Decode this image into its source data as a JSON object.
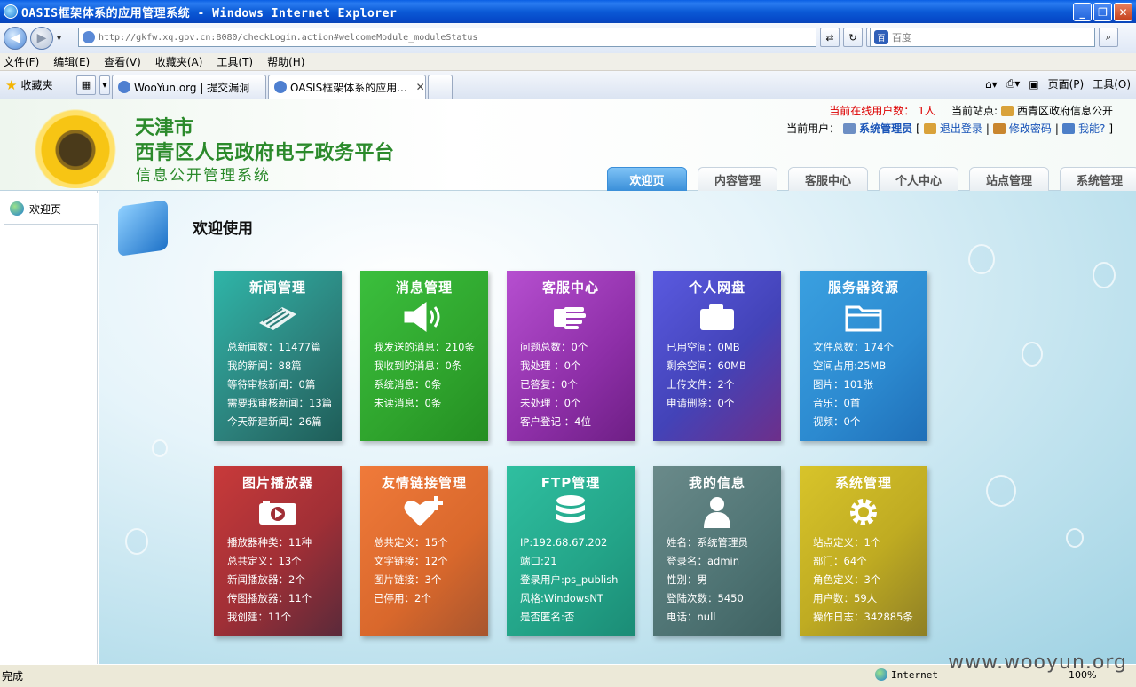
{
  "window": {
    "title": "OASIS框架体系的应用管理系统 - Windows Internet Explorer",
    "buttons": [
      "_",
      "❐",
      "✕"
    ]
  },
  "address": {
    "url": "http://gkfw.xq.gov.cn:8080/checkLogin.action#welcomeModule_moduleStatus",
    "search_placeholder": "百度"
  },
  "menu": [
    "文件(F)",
    "编辑(E)",
    "查看(V)",
    "收藏夹(A)",
    "工具(T)",
    "帮助(H)"
  ],
  "tabbar": {
    "favorites": "收藏夹",
    "tabs": [
      "WooYun.org | 提交漏洞",
      "OASIS框架体系的应用..."
    ],
    "right_page": "页面(P)",
    "right_tools": "工具(O)"
  },
  "header": {
    "logo_line1": "天津市",
    "logo_line2": "西青区人民政府电子政务平台",
    "logo_line3": "信息公开管理系统",
    "online_label": "当前在线用户数：",
    "online_count": "1人",
    "site_label": "当前站点:",
    "site_name": "西青区政府信息公开",
    "user_label": "当前用户：",
    "user_name": "系统管理员",
    "logout": "退出登录",
    "change_pwd": "修改密码",
    "help": "我能?",
    "nav_tabs": [
      "欢迎页",
      "内容管理",
      "客服中心",
      "个人中心",
      "站点管理",
      "系统管理"
    ]
  },
  "sidebar": {
    "item": "欢迎页"
  },
  "main": {
    "title": "欢迎使用",
    "cards": [
      {
        "title": "新闻管理",
        "icon": "newspaper-icon",
        "lines": [
          "总新闻数：11477篇",
          "我的新闻：88篇",
          "等待审核新闻：0篇",
          "需要我审核新闻：13篇",
          "今天新建新闻：26篇"
        ]
      },
      {
        "title": "消息管理",
        "icon": "speaker-icon",
        "lines": [
          "我发送的消息：210条",
          "我收到的消息：0条",
          "系统消息：0条",
          "未读消息：0条"
        ]
      },
      {
        "title": "客服中心",
        "icon": "hand-icon",
        "lines": [
          "问题总数：0个",
          "我处理 ：0个",
          "已答复：0个",
          "未处理 ：0个",
          "客户登记 ：4位"
        ]
      },
      {
        "title": "个人网盘",
        "icon": "camera-icon",
        "lines": [
          "已用空间：0MB",
          "剩余空间：60MB",
          "上传文件：2个",
          "申请删除：0个"
        ]
      },
      {
        "title": "服务器资源",
        "icon": "folder-icon",
        "lines": [
          "文件总数：174个",
          "空间占用:25MB",
          "图片：101张",
          "音乐：0首",
          "视频：0个"
        ]
      },
      {
        "title": "图片播放器",
        "icon": "video-icon",
        "lines": [
          "播放器种类：11种",
          "总共定义：13个",
          "新闻播放器：2个",
          "传图播放器：11个",
          "我创建：11个"
        ]
      },
      {
        "title": "友情链接管理",
        "icon": "heart-plus-icon",
        "lines": [
          "总共定义：15个",
          "文字链接：12个",
          "图片链接：3个",
          "已停用：2个"
        ]
      },
      {
        "title": "FTP管理",
        "icon": "ftp-database-icon",
        "lines": [
          "IP:192.68.67.202",
          "端口:21",
          "登录用户:ps_publish",
          "风格:WindowsNT",
          "是否匿名:否"
        ]
      },
      {
        "title": "我的信息",
        "icon": "user-icon",
        "lines": [
          "姓名：系统管理员",
          "登录名：admin",
          "性别：男",
          "登陆次数：5450",
          "电话：null"
        ]
      },
      {
        "title": "系统管理",
        "icon": "gear-icon",
        "lines": [
          "站点定义：1个",
          "部门：64个",
          "角色定义：3个",
          "用户数：59人",
          "操作日志：342885条"
        ]
      }
    ]
  },
  "status": {
    "text": "完成",
    "zone": "Internet",
    "zoom": "100%",
    "watermark": "www.wooyun.org"
  }
}
